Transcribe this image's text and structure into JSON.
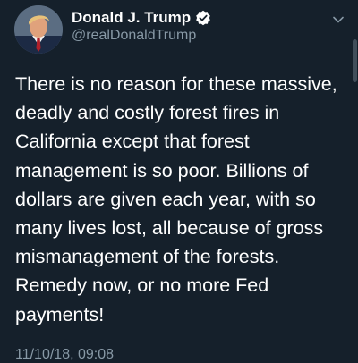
{
  "user": {
    "display_name": "Donald J. Trump",
    "handle": "@realDonaldTrump",
    "verified": true,
    "avatar": "profile-photo"
  },
  "tweet": {
    "lines": [
      "There is no reason for these massive,",
      "deadly and costly forest fires in",
      "California except that forest",
      "management is so poor. Billions of",
      "dollars are given each year, with so",
      "many lives lost, all because of gross",
      "mismanagement of the forests.",
      "Remedy now, or no more Fed",
      "payments!"
    ],
    "timestamp": "11/10/18, 09:08"
  },
  "icons": {
    "menu": "chevron-down-icon",
    "verified": "verified-badge-icon"
  },
  "colors": {
    "background": "#15202b",
    "text": "#ffffff",
    "secondary_text": "#8899a6",
    "verified_badge": "#ffffff"
  }
}
